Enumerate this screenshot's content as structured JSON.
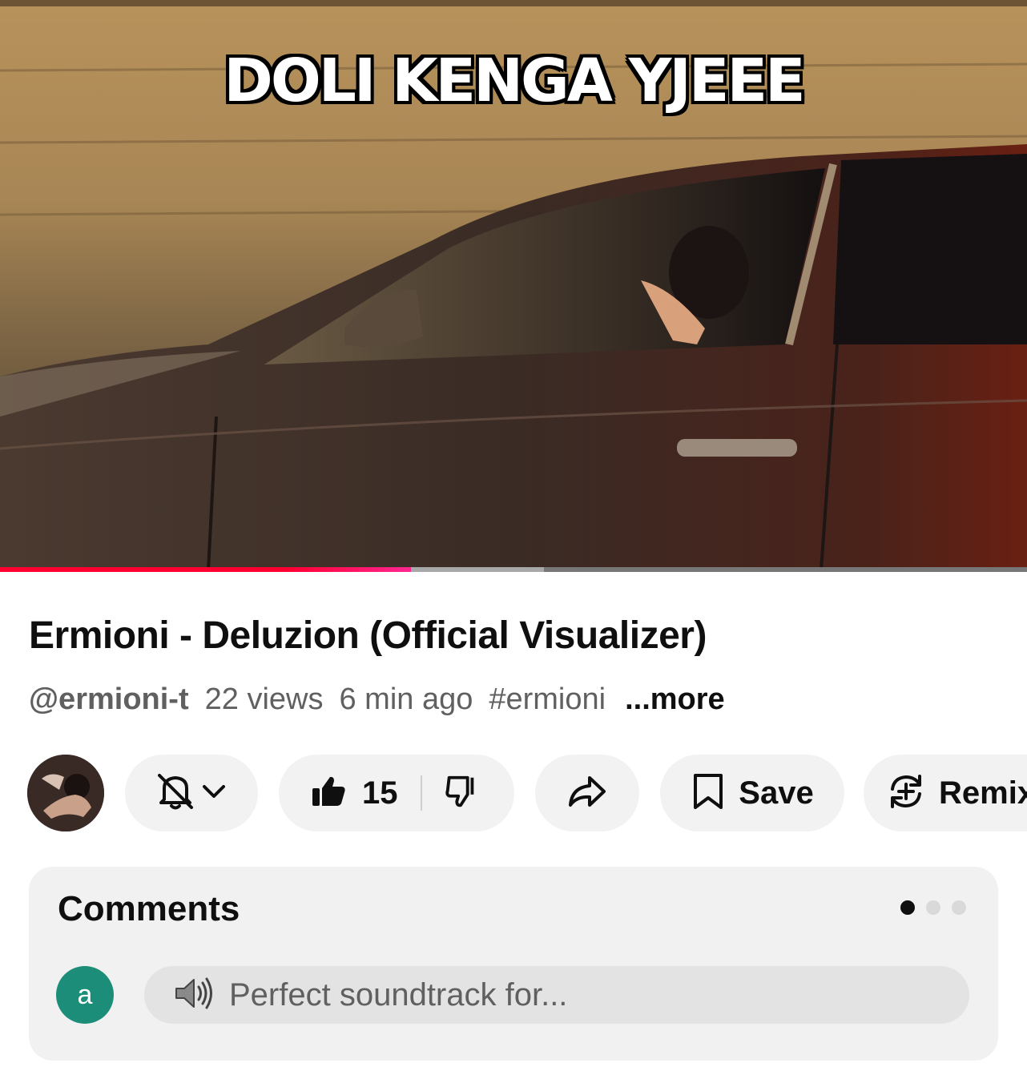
{
  "video": {
    "caption": "DOLI KENGA YJEEE",
    "progress_played": 0.4,
    "progress_buffered": 0.53
  },
  "details": {
    "title": "Ermioni - Deluzion (Official Visualizer)",
    "channel_handle": "@ermioni-t",
    "views": "22 views",
    "age": "6 min ago",
    "hashtag": "#ermioni",
    "more_label": "...more"
  },
  "actions": {
    "like_count": "15",
    "save_label": "Save",
    "remix_label": "Remix"
  },
  "comments": {
    "title": "Comments",
    "avatar_letter": "a",
    "avatar_color": "#1b8d78",
    "placeholder": "Perfect soundtrack for...",
    "placeholder_icon": "speaker-icon",
    "pager_count": 3,
    "pager_active": 0
  },
  "colors": {
    "progress_red": "#ff0033",
    "progress_pink": "#ff2791"
  }
}
